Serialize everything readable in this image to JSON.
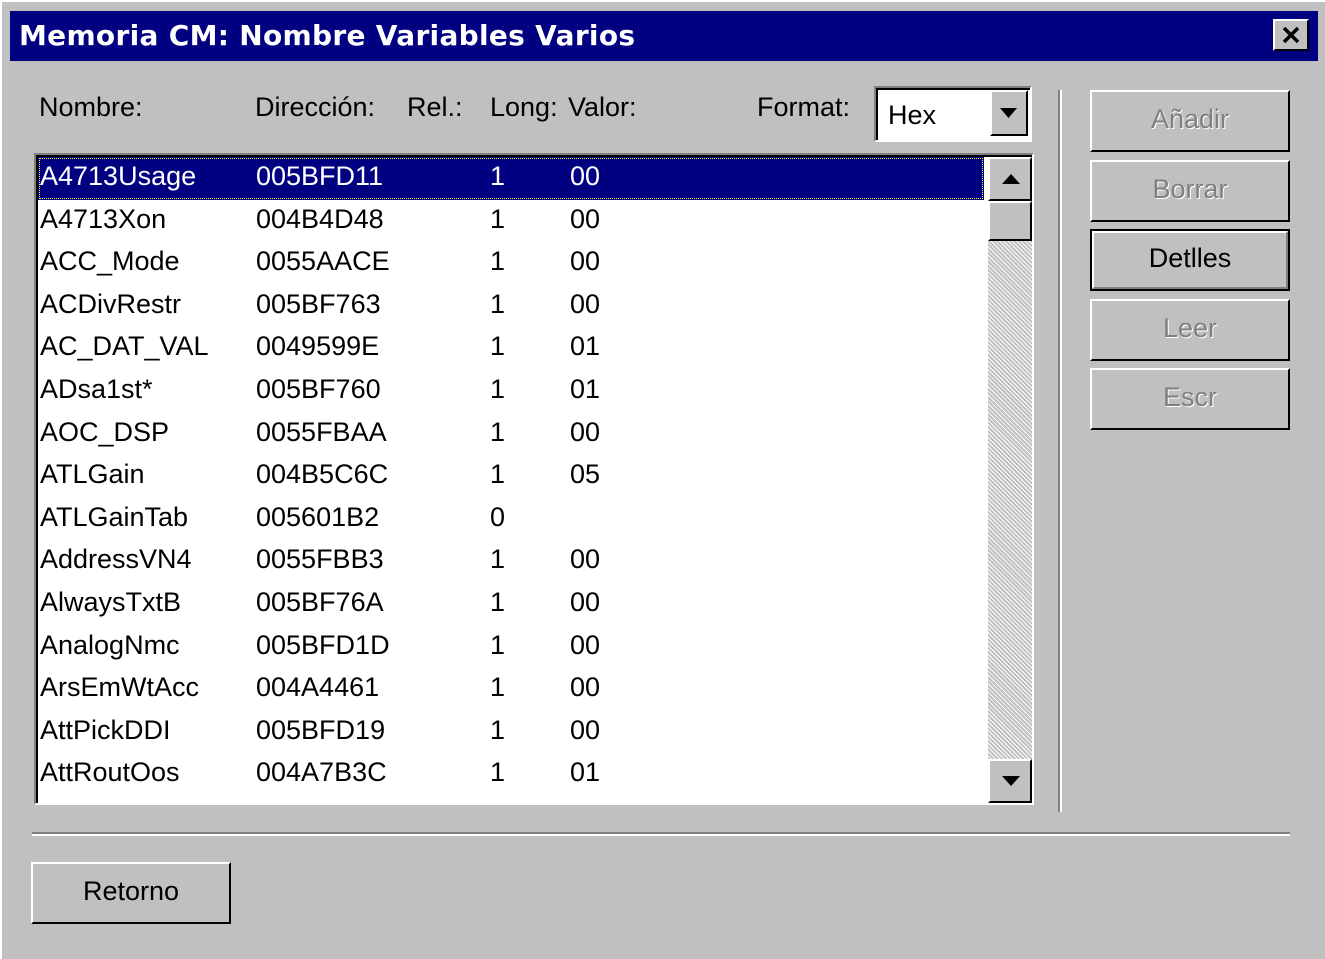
{
  "window": {
    "title": "Memoria CM: Nombre Variables Varios"
  },
  "headers": {
    "nombre": "Nombre:",
    "direccion": "Dirección:",
    "rel": "Rel.:",
    "long": "Long:",
    "valor": "Valor:",
    "format_label": "Format:"
  },
  "format": {
    "selected": "Hex"
  },
  "list": {
    "rows": [
      {
        "name": "A4713Usage",
        "addr": "005BFD11",
        "long": "1",
        "val": "00"
      },
      {
        "name": "A4713Xon",
        "addr": "004B4D48",
        "long": "1",
        "val": "00"
      },
      {
        "name": "ACC_Mode",
        "addr": "0055AACE",
        "long": "1",
        "val": "00"
      },
      {
        "name": "ACDivRestr",
        "addr": "005BF763",
        "long": "1",
        "val": "00"
      },
      {
        "name": "AC_DAT_VAL",
        "addr": "0049599E",
        "long": "1",
        "val": "01"
      },
      {
        "name": "ADsa1st*",
        "addr": "005BF760",
        "long": "1",
        "val": "01"
      },
      {
        "name": "AOC_DSP",
        "addr": "0055FBAA",
        "long": "1",
        "val": "00"
      },
      {
        "name": "ATLGain",
        "addr": "004B5C6C",
        "long": "1",
        "val": "05"
      },
      {
        "name": "ATLGainTab",
        "addr": "005601B2",
        "long": "0",
        "val": ""
      },
      {
        "name": "AddressVN4",
        "addr": "0055FBB3",
        "long": "1",
        "val": "00"
      },
      {
        "name": "AlwaysTxtB",
        "addr": "005BF76A",
        "long": "1",
        "val": "00"
      },
      {
        "name": "AnalogNmc",
        "addr": "005BFD1D",
        "long": "1",
        "val": "00"
      },
      {
        "name": "ArsEmWtAcc",
        "addr": "004A4461",
        "long": "1",
        "val": "00"
      },
      {
        "name": "AttPickDDI",
        "addr": "005BFD19",
        "long": "1",
        "val": "00"
      },
      {
        "name": "AttRoutOos",
        "addr": "004A7B3C",
        "long": "1",
        "val": "01"
      }
    ],
    "selected_index": 0
  },
  "buttons": {
    "anadir": "Añadir",
    "borrar": "Borrar",
    "detalles": "Detlles",
    "leer": "Leer",
    "escr": "Escr",
    "retorno": "Retorno"
  }
}
